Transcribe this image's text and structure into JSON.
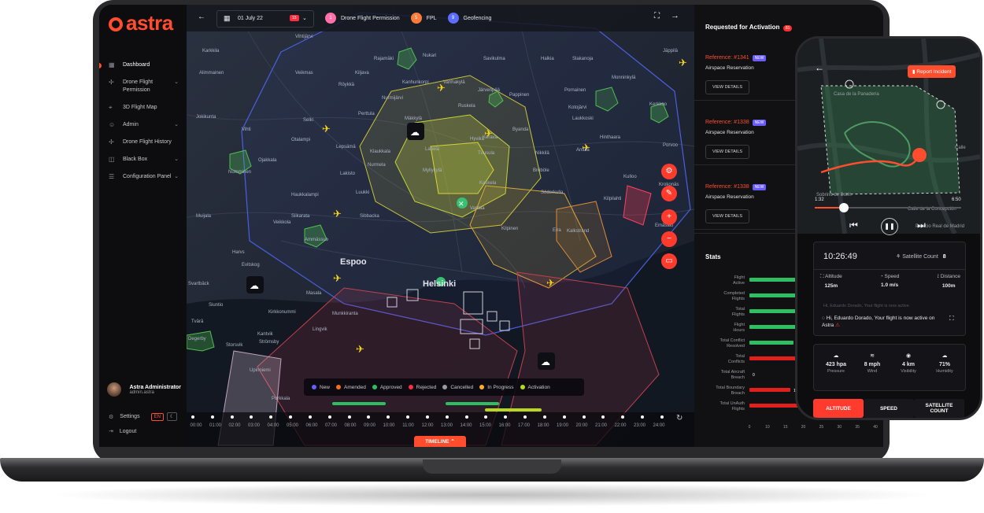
{
  "app": {
    "logo_text": "astra",
    "accent_color": "#ff4d2e"
  },
  "sidebar": {
    "items": [
      {
        "label": "Dashboard",
        "icon": "dashboard-icon",
        "has_chevron": false,
        "active": true
      },
      {
        "label": "Drone Flight Permission",
        "icon": "drone-icon",
        "has_chevron": true
      },
      {
        "label": "3D Flight Map",
        "icon": "map-icon",
        "has_chevron": false
      },
      {
        "label": "Admin",
        "icon": "admin-icon",
        "has_chevron": true
      },
      {
        "label": "Drone Flight History",
        "icon": "history-icon",
        "has_chevron": false
      },
      {
        "label": "Black Box",
        "icon": "blackbox-icon",
        "has_chevron": true
      },
      {
        "label": "Configuration Panel",
        "icon": "config-icon",
        "has_chevron": true
      }
    ],
    "user": {
      "name": "Astra Administrator",
      "email": "admin.astra"
    },
    "settings_label": "Settings",
    "lang_label": "EN",
    "logout_label": "Logout"
  },
  "topbar": {
    "date": "01 July 22",
    "date_badge": "15",
    "filters": [
      {
        "count": "1",
        "label": "Drone Flight Permission",
        "color": "#ff6fa8"
      },
      {
        "count": "5",
        "label": "FPL",
        "color": "#ff7a3d"
      },
      {
        "count": "9",
        "label": "Geofencing",
        "color": "#5b6cff"
      }
    ]
  },
  "map": {
    "places": [
      "Karkkila",
      "Vihtijärvi",
      "Rajamäki",
      "Nukari",
      "Savikulma",
      "Halkia",
      "Slakanoja",
      "Jäppilä",
      "Alimmainen",
      "Veikmas",
      "Kiljava",
      "Vanhakylä",
      "Monninkylä",
      "Röykkä",
      "Kanhunkorpi",
      "Järvenpää",
      "Pappinen",
      "Pornainen",
      "Nurmijärvi",
      "Rusikta",
      "Kotojärvi",
      "Kerkkoo",
      "Jokikunta",
      "Perttula",
      "Mäkkylä",
      "Laukkoski",
      "Selki",
      "Hyvikä",
      "Kerava",
      "Byanda",
      "Vihti",
      "Otalampi",
      "Lepsämä",
      "Klaukkala",
      "Hinthaara",
      "Lahela",
      "Tuusula",
      "Nikkilä",
      "Anttila",
      "Porvoo",
      "Ojakkala",
      "Nurmela",
      "Bröböle",
      "Kulloo",
      "Kärköskuja",
      "Numminen",
      "Lakisto",
      "Myllykylä",
      "Kaskela",
      "Söderkulla",
      "Luukki",
      "Vantaa",
      "Krokonäs",
      "Haukkalampi",
      "Kilpilahti",
      "Siikarata",
      "Sibbacka",
      "Veikkola",
      "Kilpinen",
      "Eira",
      "Kalkstrand",
      "Emäsalo",
      "Muijala",
      "Haikio",
      "Ammässuo",
      "Harvs",
      "Evitskog",
      "Espoo",
      "Svartbäck",
      "Masala",
      "Helsinki",
      "Siuntio",
      "Kirkkonummi",
      "Tvärā",
      "Lingvik",
      "Kantvik",
      "Strömsby",
      "Degerby",
      "Storsvik",
      "Upinniemi",
      "Porkkala"
    ],
    "legend": [
      {
        "label": "New",
        "color": "#6a5cff"
      },
      {
        "label": "Amended",
        "color": "#ff6a1f"
      },
      {
        "label": "Approved",
        "color": "#2fbf63"
      },
      {
        "label": "Rejected",
        "color": "#ff2d3d"
      },
      {
        "label": "Cancelled",
        "color": "#9a9aa2"
      },
      {
        "label": "In Progress",
        "color": "#ffb020"
      },
      {
        "label": "Activation",
        "color": "#b8d81e"
      }
    ]
  },
  "timeline": {
    "hours": [
      "00:00",
      "01:00",
      "02:00",
      "03:00",
      "04:00",
      "05:00",
      "06:00",
      "07:00",
      "08:00",
      "09:00",
      "10:00",
      "11:00",
      "12:00",
      "13:00",
      "14:00",
      "15:00",
      "16:00",
      "17:00",
      "18:00",
      "19:00",
      "20:00",
      "21:00",
      "22:00",
      "23:00",
      "24:00"
    ],
    "button_label": "TIMELINE"
  },
  "panel": {
    "title": "Requested for Activation",
    "title_badge": "81",
    "requests": [
      {
        "ref": "Reference: #1341",
        "tag": "NEW",
        "type": "Airspace Reservation",
        "button": "VIEW DETAILS"
      },
      {
        "ref": "Reference: #1338",
        "tag": "NEW",
        "type": "Airspace Reservation",
        "button": "VIEW DETAILS"
      },
      {
        "ref": "Reference: #1338",
        "tag": "NEW",
        "type": "Airspace Reservation",
        "button": "VIEW DETAILS"
      }
    ],
    "stats_title": "Stats"
  },
  "chart_data": {
    "type": "bar",
    "categories": [
      "Flight Active",
      "Completed Flights",
      "Total Flights",
      "Flight Hours",
      "Total Conflict Resolved",
      "Total Conflicts",
      "Total Aircraft Breach",
      "Total Boundary Breach",
      "Total UnAuth Flights"
    ],
    "values": [
      40,
      40,
      40,
      40,
      14,
      40,
      0,
      13,
      16
    ],
    "colors": [
      "#2fbf63",
      "#2fbf63",
      "#2fbf63",
      "#2fbf63",
      "#2fbf63",
      "#e0201d",
      "#e0201d",
      "#e0201d",
      "#e0201d"
    ],
    "data_labels": [
      "",
      "",
      "",
      "",
      "14",
      "",
      "0",
      "13",
      "16"
    ],
    "x_ticks": [
      "0",
      "10",
      "15",
      "20",
      "25",
      "30",
      "35",
      "40"
    ]
  },
  "phone": {
    "report_button": "Report Incident",
    "map_labels": [
      "Calle Mayor",
      "Casa de la Panaderia",
      "Calle de la Concepción",
      "Sobrino de Botín",
      "Palacio Real de Madrid"
    ],
    "time_start": "1:32",
    "time_end": "6:50",
    "progress": 0.2,
    "clock": "10:26:49",
    "satellite_label": "Satellite Count",
    "satellite_value": "8",
    "metrics": [
      {
        "label": "Altitude",
        "value": "125m"
      },
      {
        "label": "Speed",
        "value": "1.0 m/s"
      },
      {
        "label": "Distance",
        "value": "100m"
      }
    ],
    "message": "Hi, Eduardo Dorado, Your flight is now active on Astra",
    "faded_message": "Hi, Eduardo Dorado, Your flight is now active",
    "weather": [
      {
        "value": "423 hpa",
        "label": "Pressure"
      },
      {
        "value": "8 mph",
        "label": "Wind"
      },
      {
        "value": "4 km",
        "label": "Visibility"
      },
      {
        "value": "71%",
        "label": "Humidity"
      }
    ],
    "tabs": [
      "ALTITUDE",
      "SPEED",
      "SATELLITE COUNT"
    ]
  }
}
